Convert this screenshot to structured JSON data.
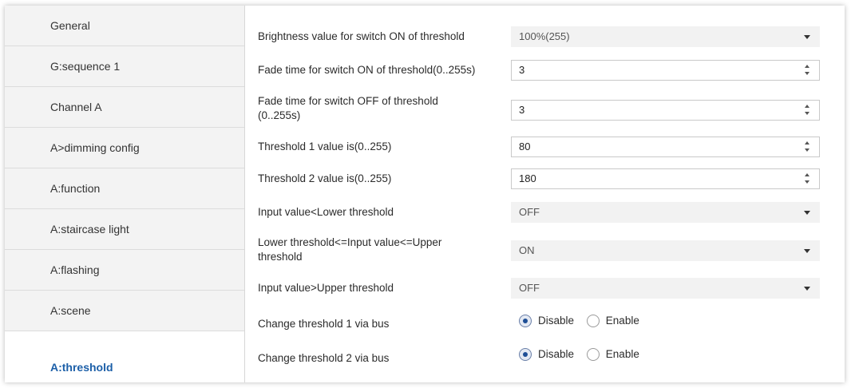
{
  "sidebar": {
    "items": [
      {
        "label": "General"
      },
      {
        "label": "G:sequence 1"
      },
      {
        "label": "Channel A"
      },
      {
        "label": "A>dimming config"
      },
      {
        "label": "A:function"
      },
      {
        "label": "A:staircase light"
      },
      {
        "label": "A:flashing"
      },
      {
        "label": "A:scene"
      },
      {
        "label": "A:threshold"
      }
    ],
    "active": "A:threshold"
  },
  "form": {
    "brightness_on": {
      "label": "Brightness value for switch ON of threshold",
      "value": "100%(255)"
    },
    "fade_on": {
      "label": "Fade time for switch ON of threshold(0..255s)",
      "value": "3"
    },
    "fade_off": {
      "label_line1": "Fade time for switch OFF of threshold",
      "label_line2": "(0..255s)",
      "value": "3"
    },
    "threshold1": {
      "label": "Threshold 1 value is(0..255)",
      "value": "80"
    },
    "threshold2": {
      "label": "Threshold 2 value is(0..255)",
      "value": "180"
    },
    "input_lower": {
      "label": "Input value<Lower threshold",
      "value": "OFF"
    },
    "input_between": {
      "label_line1": "Lower threshold<=Input value<=Upper",
      "label_line2": "threshold",
      "value": "ON"
    },
    "input_upper": {
      "label": "Input value>Upper threshold",
      "value": "OFF"
    },
    "change_t1": {
      "label": "Change threshold 1 via bus",
      "option_disable": "Disable",
      "option_enable": "Enable",
      "selected": "Disable"
    },
    "change_t2": {
      "label": "Change threshold 2 via bus",
      "option_disable": "Disable",
      "option_enable": "Enable",
      "selected": "Disable"
    }
  },
  "colors": {
    "active_nav": "#1c5fa8",
    "sidebar_bg": "#f3f3f3",
    "select_bg": "#f2f2f2"
  }
}
